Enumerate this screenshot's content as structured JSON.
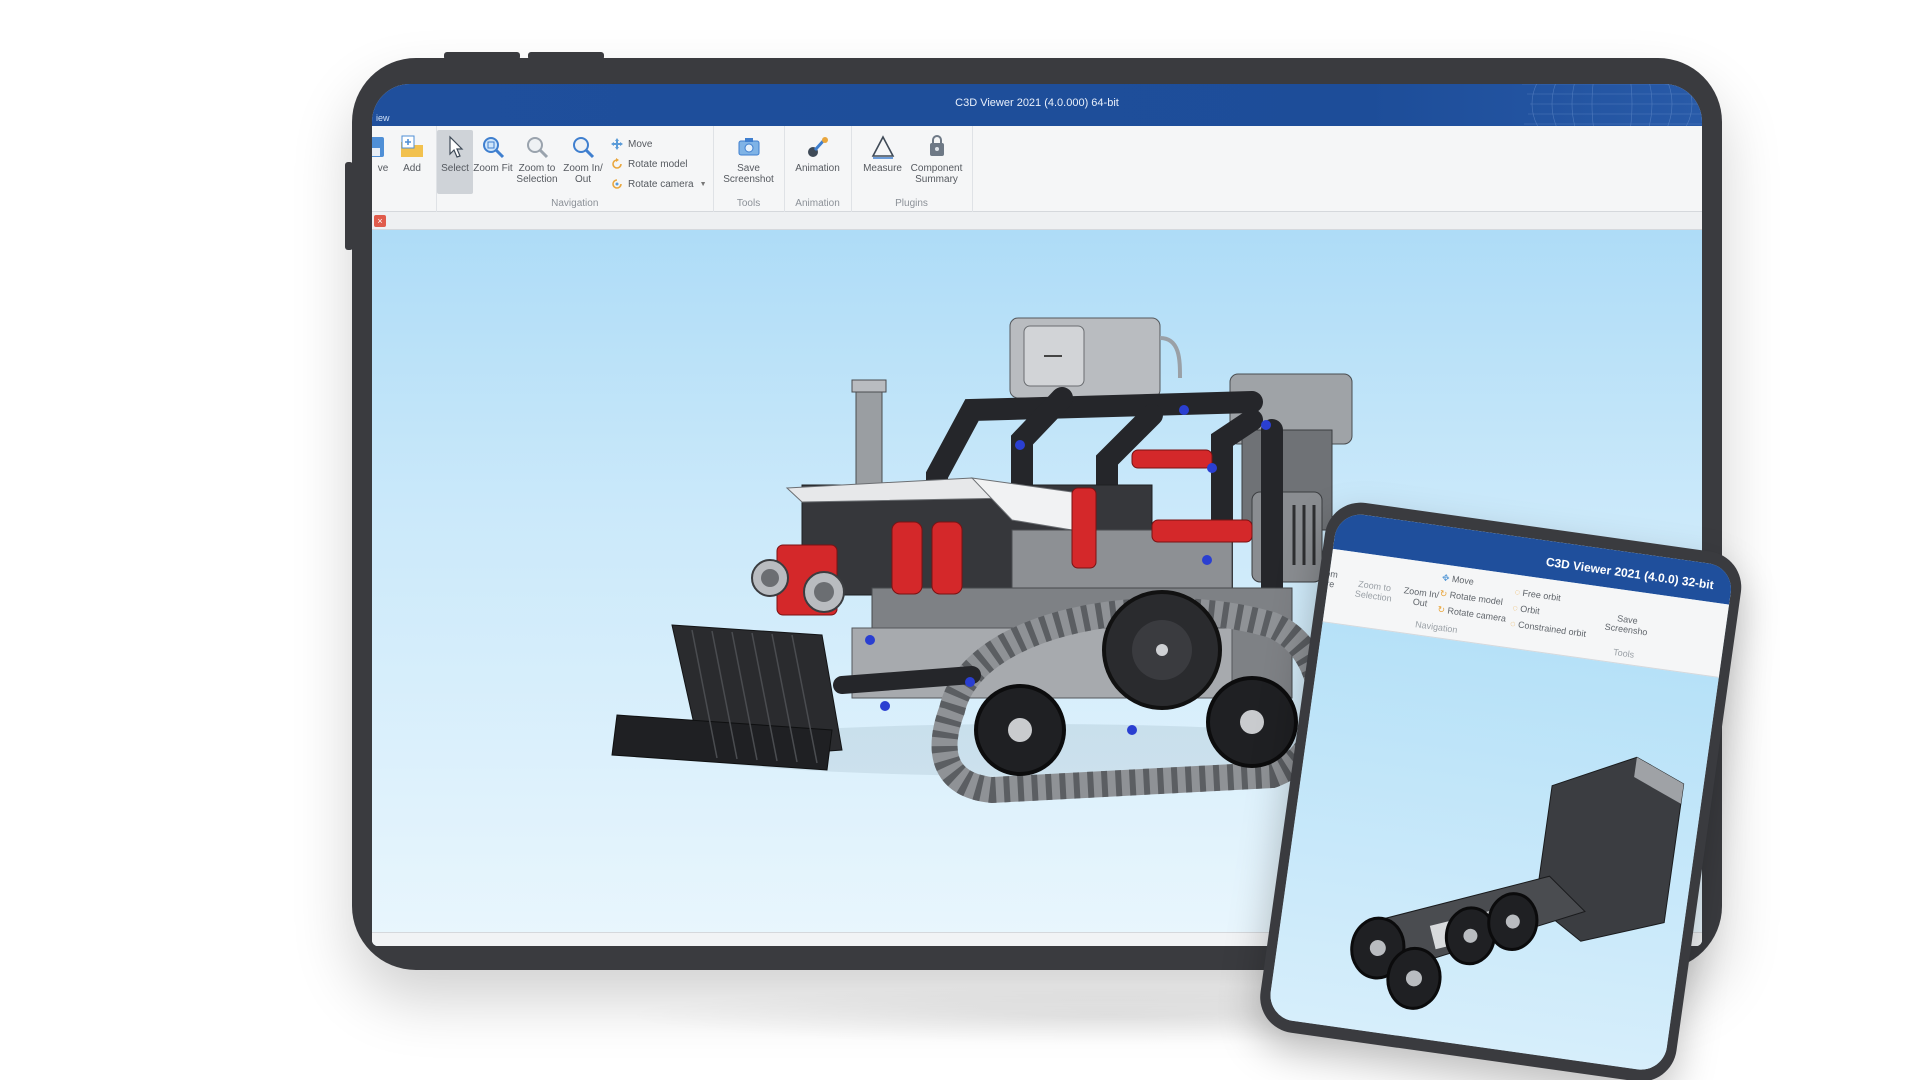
{
  "app": {
    "title": "C3D Viewer 2021 (4.0.000) 64-bit",
    "menu_tab": "iew"
  },
  "ribbon": {
    "groups": {
      "file": {
        "buttons": [
          {
            "label": "ve",
            "icon": "save-icon"
          },
          {
            "label": "Add",
            "icon": "add-folder-icon"
          }
        ]
      },
      "navigation": {
        "label": "Navigation",
        "buttons": [
          {
            "label": "Select",
            "icon": "cursor-icon"
          },
          {
            "label": "Zoom Fit",
            "icon": "zoom-fit-icon"
          },
          {
            "label": "Zoom to Selection",
            "icon": "zoom-selection-icon"
          },
          {
            "label": "Zoom In/ Out",
            "icon": "zoom-in-out-icon"
          }
        ],
        "small_buttons": [
          {
            "label": "Move",
            "icon": "move-icon"
          },
          {
            "label": "Rotate model",
            "icon": "rotate-model-icon"
          },
          {
            "label": "Rotate camera",
            "icon": "rotate-camera-icon"
          }
        ]
      },
      "tools": {
        "label": "Tools",
        "buttons": [
          {
            "label": "Save Screenshot",
            "icon": "camera-icon"
          }
        ]
      },
      "animation": {
        "label": "Animation",
        "buttons": [
          {
            "label": "Animation",
            "icon": "animation-icon"
          }
        ]
      },
      "plugins": {
        "label": "Plugins",
        "buttons": [
          {
            "label": "Measure",
            "icon": "measure-icon"
          },
          {
            "label": "Component Summary",
            "icon": "component-summary-icon"
          }
        ]
      }
    }
  },
  "secondary_device": {
    "title": "C3D Viewer 2021 (4.0.0) 32-bit",
    "ribbon_items": {
      "zoom_fit": "om\nre",
      "zoom_to_selection": "Zoom to\nSelection",
      "zoom_in_out": "Zoom In/\nOut",
      "move": "Move",
      "rotate_model": "Rotate model",
      "rotate_camera": "Rotate camera",
      "free_orbit": "Free orbit",
      "orbit": "Orbit",
      "constrained_orbit": "Constrained orbit",
      "save_screenshot": "Save\nScreensho",
      "navigation_label": "Navigation",
      "tools_label": "Tools"
    }
  },
  "colors": {
    "titlebar": "#1f4f9c",
    "ribbon_bg": "#f5f6f7",
    "viewport_top": "#aedcf7",
    "viewport_bottom": "#e9f6fd",
    "model_dark": "#2b2c2f",
    "model_gray": "#8d8f93",
    "model_red": "#d4282a",
    "model_blue": "#2a3fd1"
  }
}
